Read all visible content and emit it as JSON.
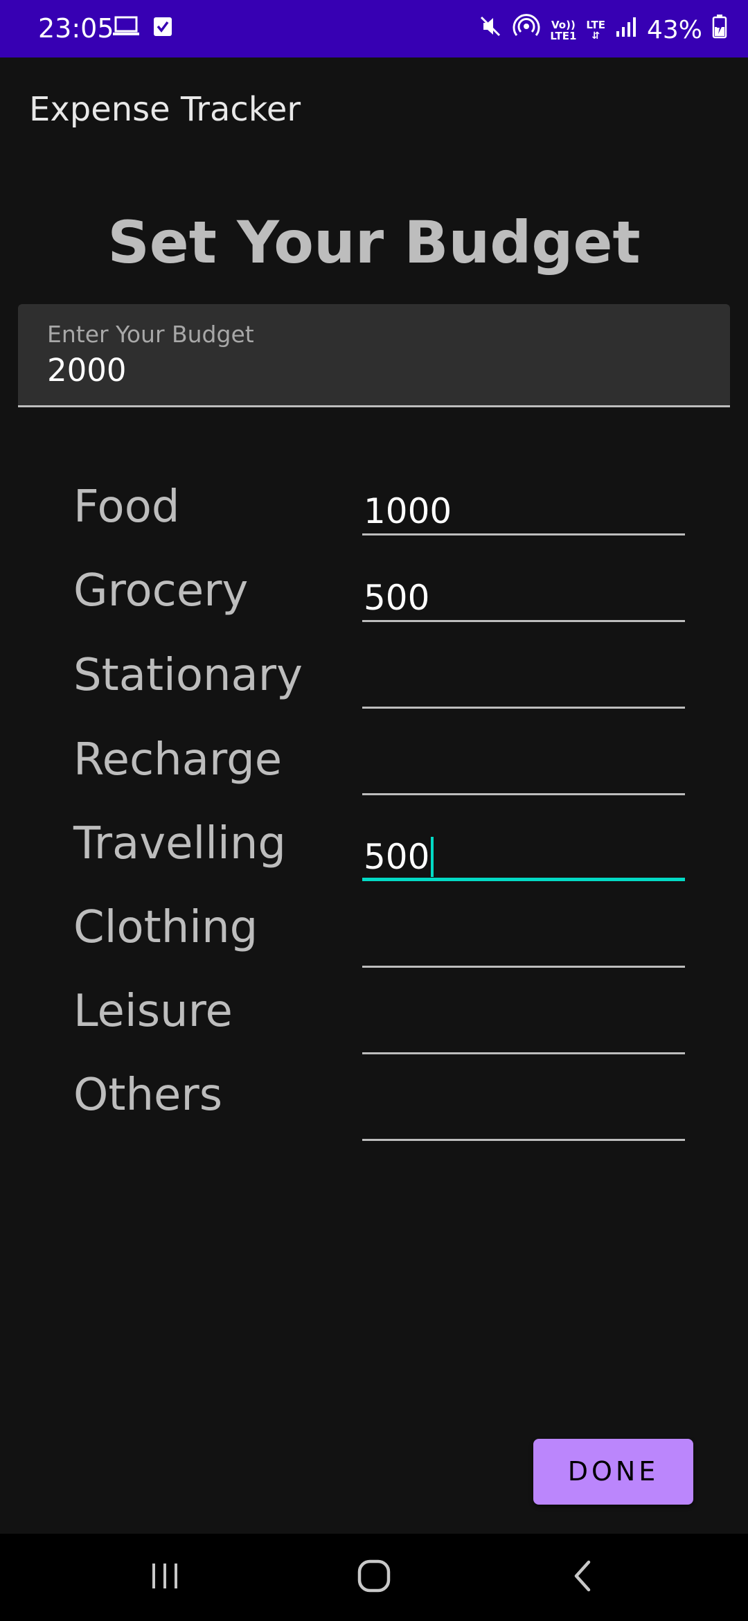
{
  "status_bar": {
    "time": "23:05",
    "battery": "43%",
    "volte_top": "Vo))",
    "volte_bottom": "LTE1",
    "lte_label": "LTE"
  },
  "app_bar": {
    "title": "Expense Tracker"
  },
  "heading": "Set Your Budget",
  "budget_field": {
    "label": "Enter Your Budget",
    "value": "2000"
  },
  "categories": [
    {
      "label": "Food",
      "value": "1000"
    },
    {
      "label": "Grocery",
      "value": "500"
    },
    {
      "label": "Stationary",
      "value": ""
    },
    {
      "label": "Recharge",
      "value": ""
    },
    {
      "label": "Travelling",
      "value": "500"
    },
    {
      "label": "Clothing",
      "value": ""
    },
    {
      "label": "Leisure",
      "value": ""
    },
    {
      "label": "Others",
      "value": ""
    }
  ],
  "done_button": {
    "label": "DONE"
  },
  "colors": {
    "status_bar": "#3700b3",
    "background": "#121212",
    "accent": "#bb86fc",
    "focus": "#03dac5"
  },
  "icons": {
    "status_left": [
      "laptop-icon",
      "checkbox-icon"
    ],
    "status_right": [
      "mute-icon",
      "hotspot-icon",
      "signal-icon",
      "battery-charging-icon"
    ],
    "nav": [
      "recents-icon",
      "home-icon",
      "back-icon"
    ]
  }
}
